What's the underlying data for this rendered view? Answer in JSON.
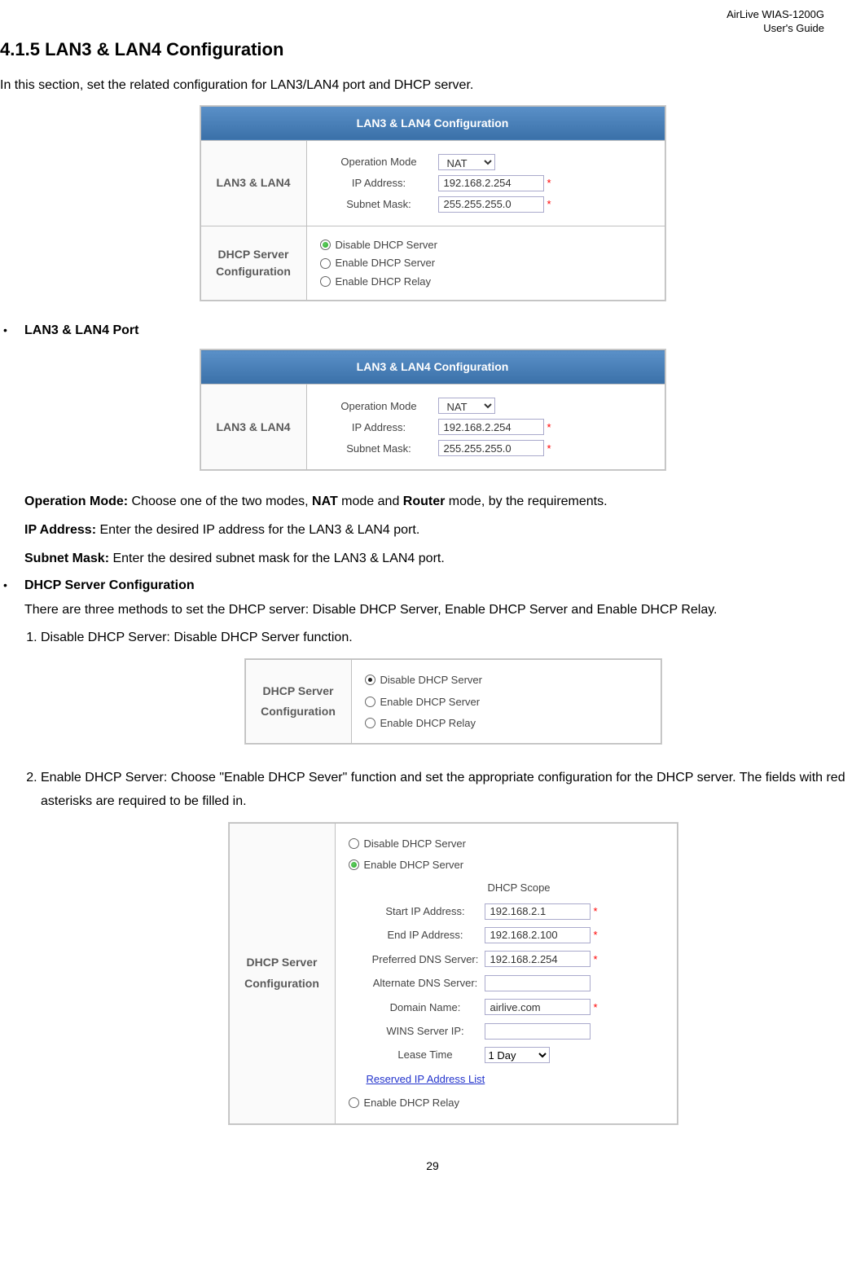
{
  "header": {
    "product": "AirLive WIAS-1200G",
    "doctype": "User's Guide"
  },
  "section_number": "4.1.5",
  "section_title": "LAN3 & LAN4 Configuration",
  "intro": "In this section, set the related configuration for LAN3/LAN4 port and DHCP server.",
  "fig1": {
    "title": "LAN3 & LAN4 Configuration",
    "row1label": "LAN3 & LAN4",
    "opmode_label": "Operation Mode",
    "opmode_value": "NAT",
    "ip_label": "IP Address:",
    "ip_value": "192.168.2.254",
    "mask_label": "Subnet Mask:",
    "mask_value": "255.255.255.0",
    "row2label": "DHCP Server Configuration",
    "r_disable": "Disable DHCP Server",
    "r_enable": "Enable DHCP Server",
    "r_relay": "Enable DHCP Relay"
  },
  "bullets": {
    "lan_port": "LAN3 & LAN4 Port",
    "dhcp_conf": "DHCP Server Configuration"
  },
  "fig2": {
    "title": "LAN3 & LAN4 Configuration",
    "row1label": "LAN3 & LAN4",
    "opmode_label": "Operation Mode",
    "opmode_value": "NAT",
    "ip_label": "IP Address:",
    "ip_value": "192.168.2.254",
    "mask_label": "Subnet Mask:",
    "mask_value": "255.255.255.0"
  },
  "desc": {
    "op_mode": "Operation Mode:",
    "op_mode_text": " Choose one of the two modes, ",
    "op_mode_text2": " mode and ",
    "op_mode_text3": " mode, by the requirements.",
    "nat": "NAT",
    "router": "Router",
    "ip": "IP Address:",
    "ip_text": " Enter the desired IP address for the LAN3 & LAN4 port.",
    "mask": "Subnet Mask:",
    "mask_text": " Enter the desired subnet mask for the LAN3 & LAN4 port.",
    "dhcp_intro": "There are three methods to set the DHCP server: ",
    "dhcp_b1": "Disable DHCP Server",
    "dhcp_b2": "Enable DHCP Server",
    "dhcp_b3": "Enable DHCP Relay",
    "and": " and ",
    "comma": ", ",
    "period": "."
  },
  "numlist": {
    "item1_b": "Disable DHCP Server:",
    "item1_t": " Disable DHCP Server function.",
    "item2_b": "Enable DHCP Server:",
    "item2_t1": " Choose ",
    "item2_q": "\"Enable DHCP Sever\"",
    "item2_t2": " function and set the appropriate configuration for the DHCP server. The fields with red asterisks are required to be filled in."
  },
  "fig3": {
    "rowlabel": "DHCP Server Configuration",
    "r_disable": "Disable DHCP Server",
    "r_enable": "Enable DHCP Server",
    "r_relay": "Enable DHCP Relay"
  },
  "fig4": {
    "rowlabel": "DHCP Server Configuration",
    "r_disable": "Disable DHCP Server",
    "r_enable": "Enable DHCP Server",
    "r_relay": "Enable DHCP Relay",
    "scope_title": "DHCP Scope",
    "start_ip_label": "Start IP Address:",
    "start_ip_value": "192.168.2.1",
    "end_ip_label": "End IP Address:",
    "end_ip_value": "192.168.2.100",
    "pdns_label": "Preferred DNS Server:",
    "pdns_value": "192.168.2.254",
    "adns_label": "Alternate DNS Server:",
    "adns_value": "",
    "domain_label": "Domain Name:",
    "domain_value": "airlive.com",
    "wins_label": "WINS Server IP:",
    "wins_value": "",
    "lease_label": "Lease Time",
    "lease_value": "1 Day",
    "reserved_link": "Reserved IP Address List"
  },
  "page_number": "29"
}
